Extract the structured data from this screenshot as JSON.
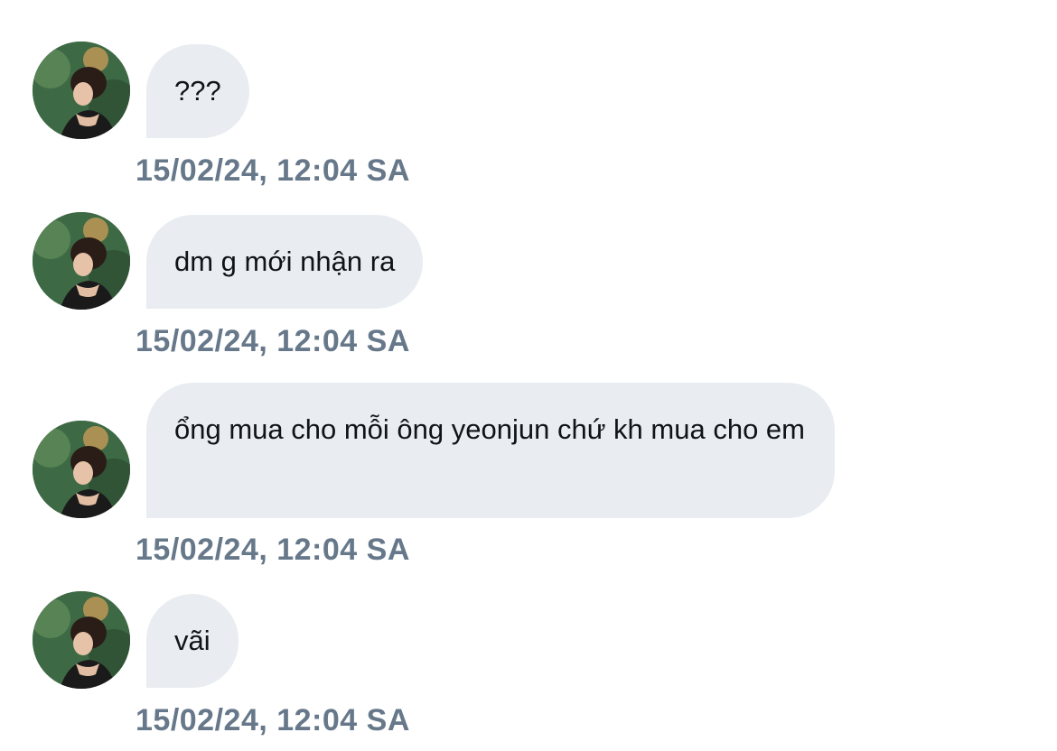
{
  "messages": [
    {
      "text": "???",
      "timestamp": "15/02/24, 12:04 SA",
      "avatar_icon": "user-avatar-photo"
    },
    {
      "text": "dm g mới nhận ra",
      "timestamp": "15/02/24, 12:04 SA",
      "avatar_icon": "user-avatar-photo"
    },
    {
      "text": "ổng mua cho mỗi ông yeonjun chứ kh mua cho em",
      "timestamp": "15/02/24, 12:04 SA",
      "avatar_icon": "user-avatar-photo"
    },
    {
      "text": "vãi",
      "timestamp": "15/02/24, 12:04 SA",
      "avatar_icon": "user-avatar-photo"
    }
  ],
  "colors": {
    "bubble_bg": "#e9edf1",
    "bubble_text": "#101418",
    "timestamp": "#66788a",
    "background": "#ffffff"
  }
}
